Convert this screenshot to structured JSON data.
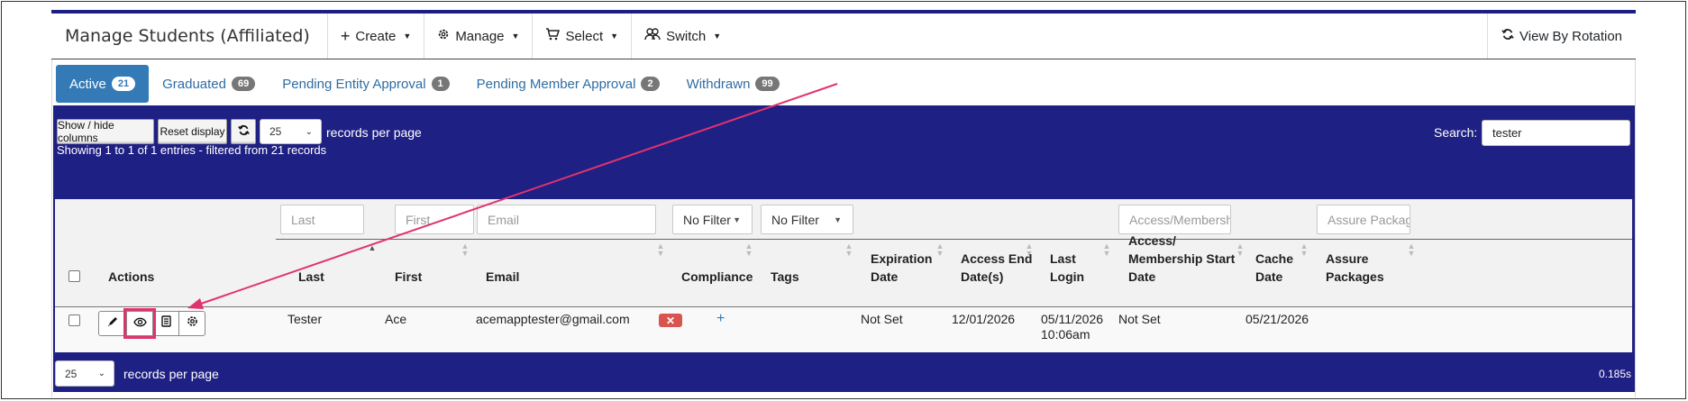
{
  "header": {
    "title": "Manage Students (Affiliated)",
    "menus": [
      {
        "label": "Create",
        "icon": "plus-icon"
      },
      {
        "label": "Manage",
        "icon": "gear-icon"
      },
      {
        "label": "Select",
        "icon": "cart-icon"
      },
      {
        "label": "Switch",
        "icon": "users-icon"
      }
    ],
    "view_by_rotation": "View By Rotation"
  },
  "tabs": [
    {
      "label": "Active",
      "count": "21",
      "active": true
    },
    {
      "label": "Graduated",
      "count": "69"
    },
    {
      "label": "Pending Entity Approval",
      "count": "1"
    },
    {
      "label": "Pending Member Approval",
      "count": "2"
    },
    {
      "label": "Withdrawn",
      "count": "99"
    }
  ],
  "toolbar": {
    "show_hide_columns": "Show / hide columns",
    "reset_display": "Reset display",
    "page_size": "25",
    "records_per_page": "records per page",
    "search_label": "Search:",
    "search_value": "tester"
  },
  "info": {
    "showing": "Showing 1 to 1 of 1 entries - filtered from 21 records"
  },
  "filters": {
    "last_placeholder": "Last",
    "first_placeholder": "First",
    "email_placeholder": "Email",
    "compliance_filter": "No Filter",
    "tags_filter": "No Filter",
    "access_placeholder": "Access/Membership",
    "assure_placeholder": "Assure Package"
  },
  "columns": {
    "actions": "Actions",
    "last": "Last",
    "first": "First",
    "email": "Email",
    "compliance": "Compliance",
    "tags": "Tags",
    "expiration_1": "Expiration",
    "expiration_2": "Date",
    "access_end_1": "Access End",
    "access_end_2": "Date(s)",
    "last_login_1": "Last",
    "last_login_2": "Login",
    "access_start_1": "Access/",
    "access_start_2": "Membership Start",
    "access_start_3": "Date",
    "cache_1": "Cache",
    "cache_2": "Date",
    "assure_1": "Assure",
    "assure_2": "Packages"
  },
  "rows": [
    {
      "last": "Tester",
      "first": "Ace",
      "email": "acemapptester@gmail.com",
      "compliance_mark": "✕",
      "tags_add": "+",
      "expiration": "Not Set",
      "access_end": "12/01/2026",
      "last_login_date": "05/11/2026",
      "last_login_time": "10:06am",
      "access_start": "Not Set",
      "cache_date": "05/21/2026",
      "assure_packages": ""
    }
  ],
  "footer": {
    "page_size": "25",
    "records_per_page": "records per page",
    "elapsed": "0.185s"
  },
  "colors": {
    "navy": "#1f2084",
    "accent_blue": "#337ab7",
    "danger": "#d9534f",
    "annotation": "#e0336d"
  }
}
